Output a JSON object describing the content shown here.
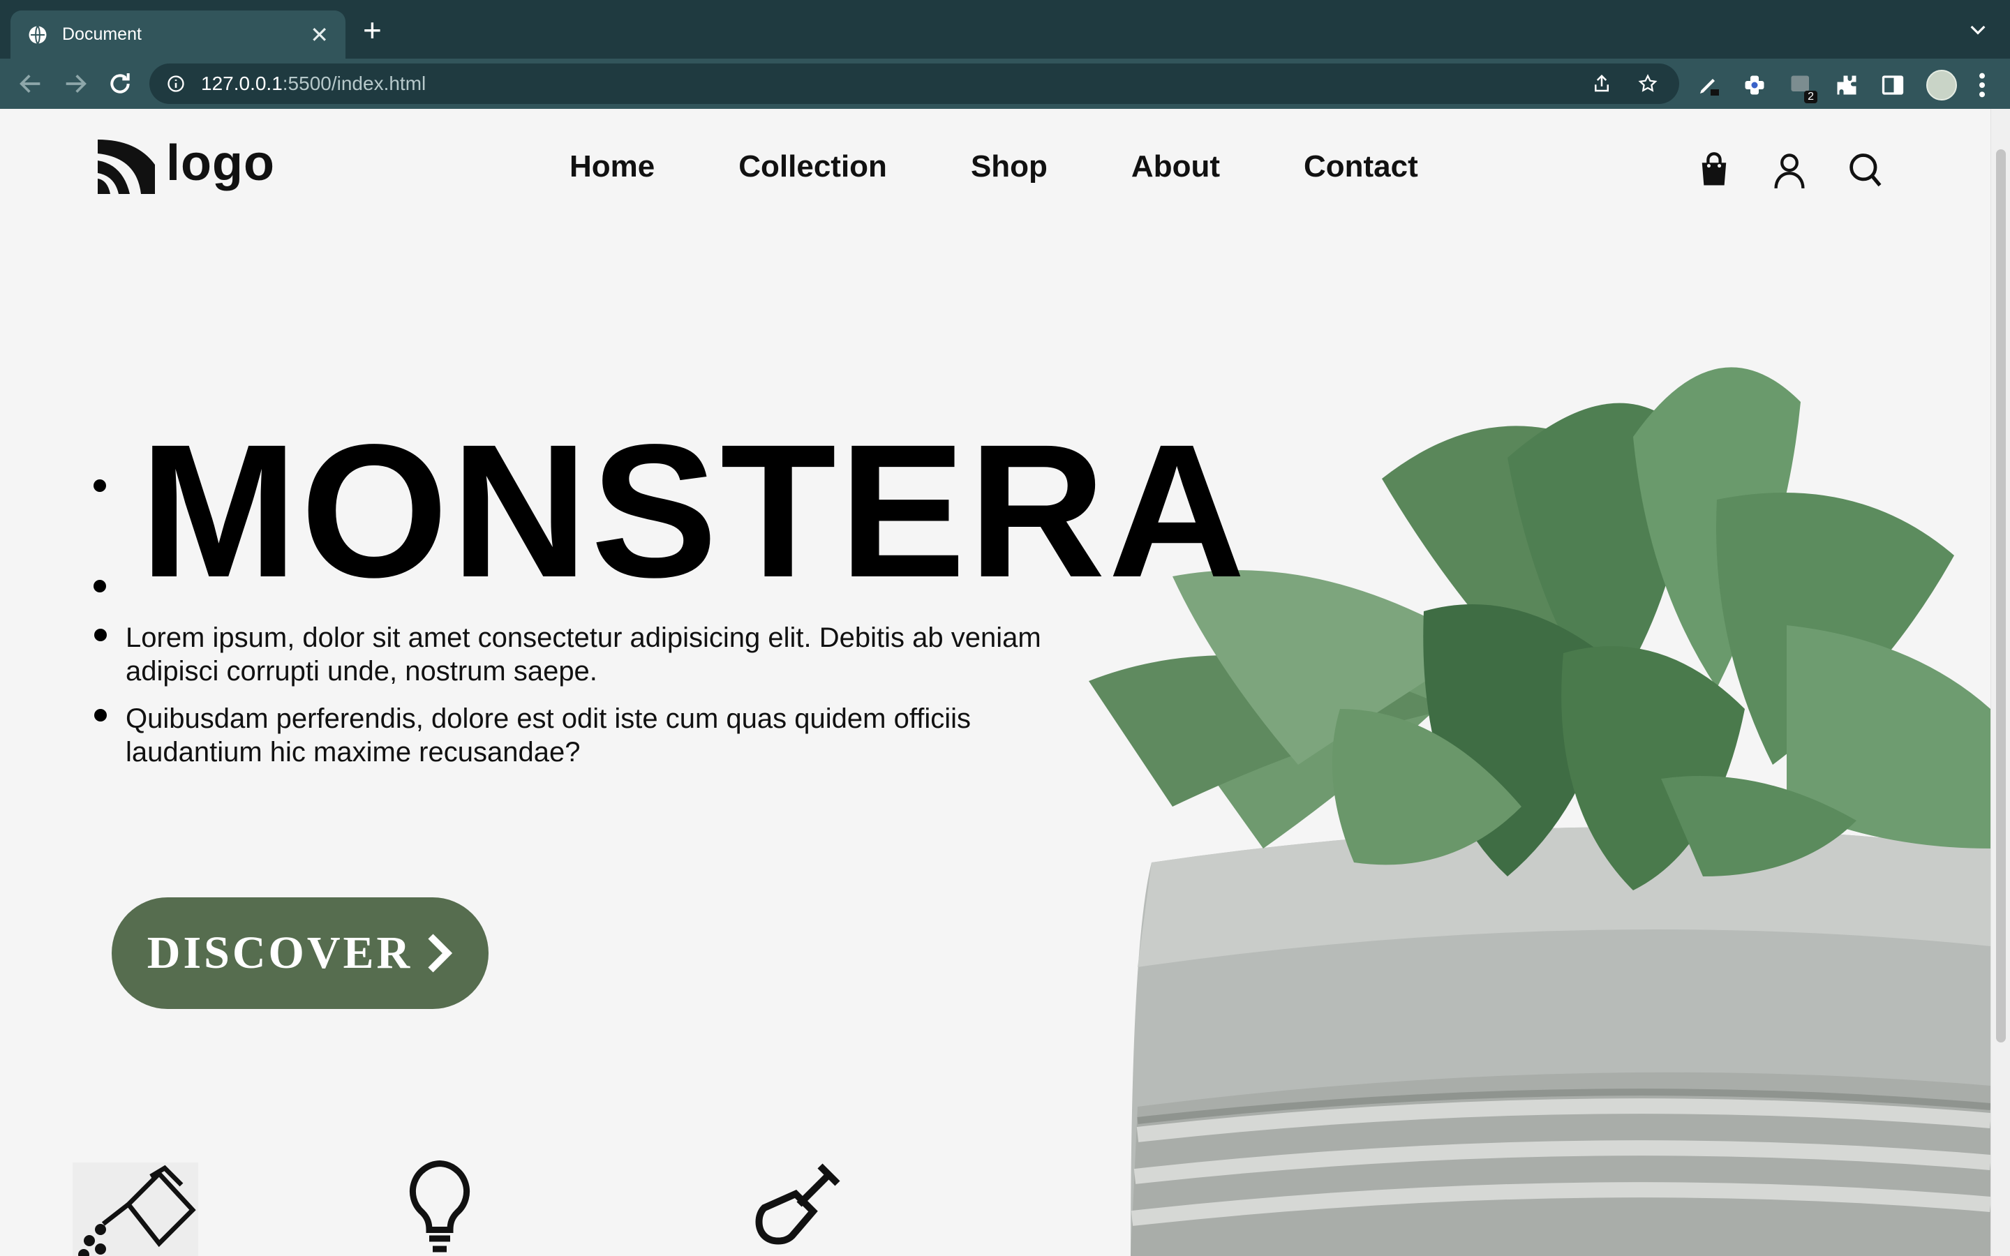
{
  "browser": {
    "tab_title": "Document",
    "new_tab_label": "+",
    "close_label": "✕",
    "url_host": "127.0.0.1",
    "url_path": ":5500/index.html",
    "extension_badge": "2"
  },
  "site": {
    "logo_text": "logo",
    "nav": [
      "Home",
      "Collection",
      "Shop",
      "About",
      "Contact"
    ],
    "icons": [
      "shopping-bag-icon",
      "user-icon",
      "search-icon"
    ]
  },
  "hero": {
    "title": "MONSTERA",
    "paragraphs": [
      "Lorem ipsum, dolor sit amet consectetur adipisicing elit. Debitis ab veniam adipisci corrupti unde, nostrum saepe.",
      "Quibusdam perferendis, dolore est odit iste cum quas quidem officiis laudantium hic maxime recusandae?"
    ],
    "button_label": "DISCOVER"
  },
  "features": {
    "icons": [
      "watering-can-icon",
      "lightbulb-icon",
      "shovel-icon"
    ]
  },
  "colors": {
    "tabbar": "#1f3a40",
    "toolbar": "#32555b",
    "page_bg": "#f5f5f5",
    "accent": "#566d4f",
    "text": "#111111"
  }
}
